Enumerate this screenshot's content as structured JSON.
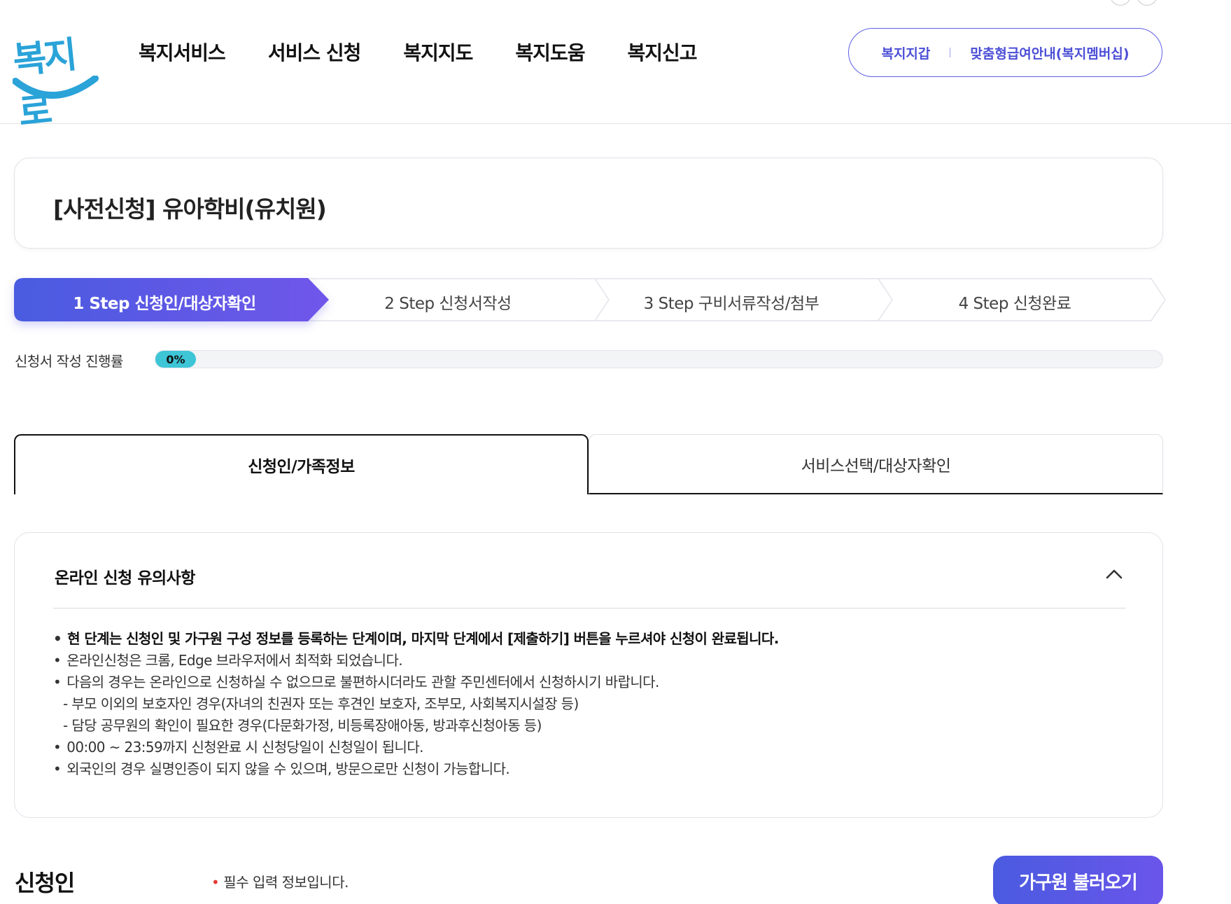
{
  "header": {
    "logo_text": "복지로",
    "nav": [
      "복지서비스",
      "서비스 신청",
      "복지지도",
      "복지도움",
      "복지신고"
    ],
    "util_links": [
      "복지지갑",
      "맞춤형급여안내(복지멤버십)"
    ]
  },
  "page": {
    "title": "[사전신청] 유아학비(유치원)"
  },
  "steps": [
    {
      "label": "1 Step 신청인/대상자확인",
      "active": true
    },
    {
      "label": "2 Step 신청서작성",
      "active": false
    },
    {
      "label": "3 Step 구비서류작성/첨부",
      "active": false
    },
    {
      "label": "4 Step 신청완료",
      "active": false
    }
  ],
  "progress": {
    "label": "신청서 작성 진행률",
    "value_text": "0%",
    "value": 0
  },
  "tabs": {
    "active": "신청인/가족정보",
    "inactive": "서비스선택/대상자확인"
  },
  "notice": {
    "title": "온라인 신청 유의사항",
    "items": [
      "현 단계는 신청인 및 가구원 구성 정보를 등록하는 단계이며, 마지막 단계에서 [제출하기] 버튼을 누르셔야 신청이 완료됩니다.",
      "온라인신청은 크롬, Edge 브라우저에서 최적화 되었습니다.",
      "다음의 경우는 온라인으로 신청하실 수 없으므로 불편하시더라도 관할 주민센터에서 신청하시기 바랍니다.",
      "- 부모 이외의 보호자인 경우(자녀의 친권자 또는 후견인 보호자, 조부모, 사회복지시설장 등)",
      "- 담당 공무원의 확인이 필요한 경우(다문화가정, 비등록장애아동, 방과후신청아동 등)",
      "00:00 ~ 23:59까지 신청완료 시 신청당일이 신청일이 됩니다.",
      "외국인의 경우 실명인증이 되지 않을 수 있으며, 방문으로만 신청이 가능합니다."
    ]
  },
  "applicant": {
    "title": "신청인",
    "required_note": "필수 입력 정보입니다.",
    "load_button": "가구원 불러오기"
  },
  "colors": {
    "brand_blue": "#4b4ed6",
    "step_active_start": "#4a5be0",
    "step_active_end": "#7057ea",
    "progress": "#3ec5d6",
    "logo": "#2aa3d8",
    "required": "#e53935"
  }
}
